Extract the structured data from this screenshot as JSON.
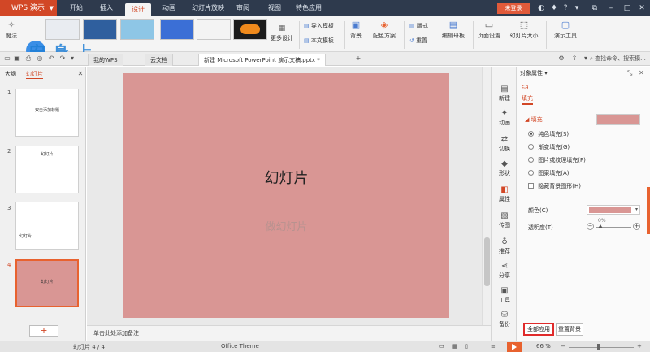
{
  "colors": {
    "accent": "#d24726",
    "slide_bg": "#d99694",
    "titlebar": "#2e3a4d",
    "highlight": "#e02b2b"
  },
  "app": {
    "name": "WPS 演示"
  },
  "menu_tabs": [
    "开始",
    "插入",
    "设计",
    "动画",
    "幻灯片放映",
    "审阅",
    "视图",
    "特色应用"
  ],
  "active_tab": "设计",
  "login_label": "未登录",
  "ribbon": {
    "magic": "魔法",
    "more_design": "更多设计",
    "import_template": "导入模板",
    "this_template": "本文模板",
    "background": "背景",
    "color_scheme": "配色方案",
    "layout": "版式",
    "reset": "重置",
    "edit_master": "编辑母板",
    "page_setup": "页面设置",
    "slide_size": "幻灯片大小",
    "presentation_tools": "演示工具"
  },
  "watermark_text": "安 身 上",
  "doc_tabs": [
    "我的WPS",
    "云文档",
    "新建 Microsoft PowerPoint 演示文稿.pptx *"
  ],
  "search_placeholder": "查找命令、搜索模...",
  "left_panel": {
    "tabs": [
      "大纲",
      "幻灯片"
    ],
    "slides": [
      {
        "num": "1",
        "title": "双击添加标题"
      },
      {
        "num": "2",
        "title": "幻灯片"
      },
      {
        "num": "3",
        "title": "幻灯片"
      },
      {
        "num": "4",
        "title": "幻灯片"
      }
    ],
    "add_label": "+"
  },
  "slide": {
    "title": "幻灯片",
    "subtitle": "做幻灯片"
  },
  "notes_placeholder": "单击此处添加备注",
  "side_strip": [
    "新建",
    "动画",
    "切换",
    "形状",
    "属性",
    "传图",
    "推荐",
    "分享",
    "工具",
    "备份"
  ],
  "property_panel": {
    "title": "对象属性",
    "fill_tab": "填充",
    "section": "填充",
    "options": [
      "纯色填充(S)",
      "渐变填充(G)",
      "图片或纹理填充(P)",
      "图案填充(A)"
    ],
    "hide_bg": "隐藏背景图形(H)",
    "color_label": "颜色(C)",
    "transparency_label": "透明度(T)",
    "transparency_value": "0%",
    "apply_all": "全部应用",
    "reset_bg": "重置背景"
  },
  "status": {
    "slide_info": "幻灯片 4 / 4",
    "theme": "Office Theme",
    "zoom": "66 %"
  }
}
